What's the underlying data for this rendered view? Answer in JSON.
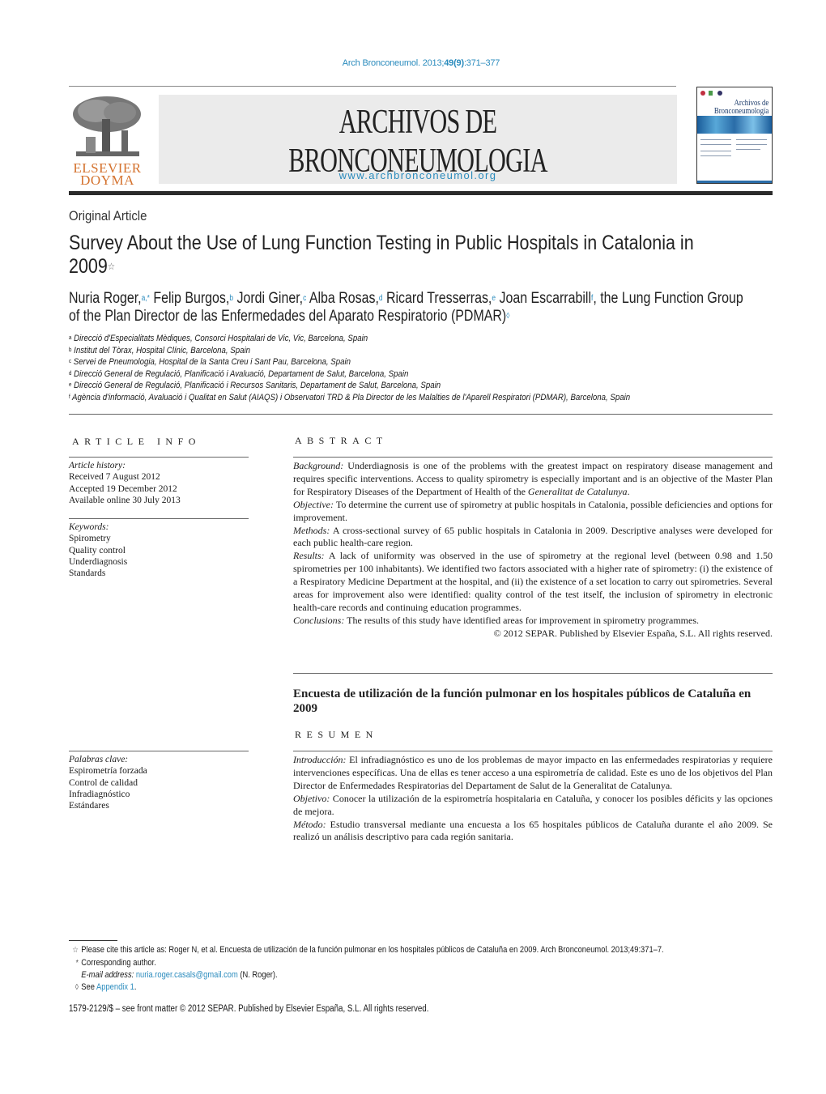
{
  "header": {
    "citation_prefix": "Arch Bronconeumol. 2013;",
    "citation_volume": "49",
    "citation_issue": "(9)",
    "citation_pages": ":371–377",
    "publisher_logo_line1": "ELSEVIER",
    "publisher_logo_line2": "DOYMA",
    "journal_title": "ARCHIVOS DE BRONCONEUMOLOGIA",
    "journal_url": "www.archbronconeumol.org",
    "cover_title_line1": "Archivos de",
    "cover_title_line2": "Bronconeumología"
  },
  "article": {
    "type": "Original Article",
    "title": "Survey About the Use of Lung Function Testing in Public Hospitals in Catalonia in 2009",
    "title_mark": "☆",
    "authors": [
      {
        "name": "Nuria Roger,",
        "sup": "a,*"
      },
      {
        "name": " Felip Burgos,",
        "sup": "b"
      },
      {
        "name": " Jordi Giner,",
        "sup": "c"
      },
      {
        "name": " Alba Rosas,",
        "sup": "d"
      },
      {
        "name": " Ricard Tresserras,",
        "sup": "e"
      },
      {
        "name": " Joan Escarrabill",
        "sup": "f"
      },
      {
        "name": ", the Lung Function Group of the Plan Director de las Enfermedades del Aparato Respiratorio (PDMAR)",
        "sup": "◊"
      }
    ],
    "affiliations": [
      {
        "mark": "a",
        "text": "Direcció d'Especialitats Mèdiques, Consorci Hospitalari de Vic, Vic, Barcelona, Spain"
      },
      {
        "mark": "b",
        "text": "Institut del Tòrax, Hospital Clínic, Barcelona, Spain"
      },
      {
        "mark": "c",
        "text": "Servei de Pneumologia, Hospital de la Santa Creu i Sant Pau, Barcelona, Spain"
      },
      {
        "mark": "d",
        "text": "Direcció General de Regulació, Planificació i Avaluació, Departament de Salut, Barcelona, Spain"
      },
      {
        "mark": "e",
        "text": "Direcció General de Regulació, Planificació i Recursos Sanitaris, Departament de Salut, Barcelona, Spain"
      },
      {
        "mark": "f",
        "text": "Agència d'informació, Avaluació i Qualitat en Salut (AIAQS) i Observatori TRD & Pla Director de les Malalties de l'Aparell Respiratori (PDMAR), Barcelona, Spain"
      }
    ]
  },
  "article_info": {
    "heading": "ARTICLE INFO",
    "history_label": "Article history:",
    "history": [
      "Received 7 August 2012",
      "Accepted 19 December 2012",
      "Available online 30 July 2013"
    ],
    "keywords_label": "Keywords:",
    "keywords": [
      "Spirometry",
      "Quality control",
      "Underdiagnosis",
      "Standards"
    ],
    "keywords_es_label": "Palabras clave:",
    "keywords_es": [
      "Espirometría forzada",
      "Control de calidad",
      "Infradiagnóstico",
      "Estándares"
    ]
  },
  "abstract": {
    "heading": "ABSTRACT",
    "sections": [
      {
        "label": "Background:",
        "text": " Underdiagnosis is one of the problems with the greatest impact on respiratory disease management and requires specific interventions. Access to quality spirometry is especially important and is an objective of the Master Plan for Respiratory Diseases of the Department of Health of the ",
        "italic_tail": "Generalitat de Catalunya",
        "end": "."
      },
      {
        "label": "Objective:",
        "text": " To determine the current use of spirometry at public hospitals in Catalonia, possible deficiencies and options for improvement."
      },
      {
        "label": "Methods:",
        "text": " A cross-sectional survey of 65 public hospitals in Catalonia in 2009. Descriptive analyses were developed for each public health-care region."
      },
      {
        "label": "Results:",
        "text": " A lack of uniformity was observed in the use of spirometry at the regional level (between 0.98 and 1.50 spirometries per 100 inhabitants). We identified two factors associated with a higher rate of spirometry: (i) the existence of a Respiratory Medicine Department at the hospital, and (ii) the existence of a set location to carry out spirometries. Several areas for improvement also were identified: quality control of the test itself, the inclusion of spirometry in electronic health-care records and continuing education programmes."
      },
      {
        "label": "Conclusions:",
        "text": " The results of this study have identified areas for improvement in spirometry programmes."
      }
    ],
    "copyright": "© 2012 SEPAR. Published by Elsevier España, S.L. All rights reserved."
  },
  "spanish": {
    "title": "Encuesta de utilización de la función pulmonar en los hospitales públicos de Cataluña en 2009",
    "heading": "RESUMEN",
    "sections": [
      {
        "label": "Introducción:",
        "text": " El infradiagnóstico es uno de los problemas de mayor impacto en las enfermedades respiratorias y requiere intervenciones específicas. Una de ellas es tener acceso a una espirometría de calidad. Este es uno de los objetivos del Plan Director de Enfermedades Respiratorias del Departament de Salut de la Generalitat de Catalunya."
      },
      {
        "label": "Objetivo:",
        "text": " Conocer la utilización de la espirometría hospitalaria en Cataluña, y conocer los posibles déficits y las opciones de mejora."
      },
      {
        "label": "Método:",
        "text": " Estudio transversal mediante una encuesta a los 65 hospitales públicos de Cataluña durante el año 2009. Se realizó un análisis descriptivo para cada región sanitaria."
      }
    ]
  },
  "footnotes": {
    "cite_mark": "☆",
    "cite_text": "Please cite this article as: Roger N, et al. Encuesta de utilización de la función pulmonar en los hospitales públicos de Cataluña en 2009. Arch Bronconeumol. 2013;49:371–7.",
    "corr_mark": "*",
    "corr_text": "Corresponding author.",
    "email_label": "E-mail address:",
    "email": "nuria.roger.casals@gmail.com",
    "email_suffix": " (N. Roger).",
    "see_mark": "◊",
    "see_text": "See ",
    "see_link": "Appendix 1",
    "see_end": ".",
    "front_matter": "1579-2129/$ – see front matter © 2012 SEPAR. Published by Elsevier España, S.L. All rights reserved."
  },
  "colors": {
    "link": "#2a8bbd",
    "elsevier_orange": "#d4722e",
    "banner_bg": "#ebebeb"
  }
}
